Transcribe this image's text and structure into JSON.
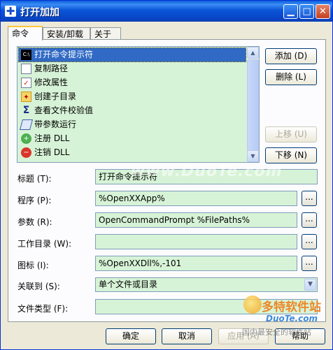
{
  "window": {
    "title": "打开加加",
    "controls": [
      "minimize",
      "maximize",
      "close"
    ]
  },
  "tabs": [
    {
      "label": "命令",
      "active": true
    },
    {
      "label": "安装/卸载",
      "active": false
    },
    {
      "label": "关于",
      "active": false
    }
  ],
  "commands": [
    {
      "label": "打开命令提示符",
      "icon": "console-icon",
      "selected": true
    },
    {
      "label": "复制路径",
      "icon": "document-icon",
      "selected": false
    },
    {
      "label": "修改属性",
      "icon": "checklist-icon",
      "selected": false
    },
    {
      "label": "创建子目录",
      "icon": "new-folder-icon",
      "selected": false
    },
    {
      "label": "查看文件校验值",
      "icon": "sigma-icon",
      "selected": false
    },
    {
      "label": "带参数运行",
      "icon": "run-icon",
      "selected": false
    },
    {
      "label": "注册 DLL",
      "icon": "register-icon",
      "selected": false
    },
    {
      "label": "注销 DLL",
      "icon": "unregister-icon",
      "selected": false
    }
  ],
  "side_buttons": {
    "add": "添加 (D)",
    "delete": "删除 (L)",
    "up": "上移 (U)",
    "down": "下移 (N)"
  },
  "form": {
    "title_label": "标题 (T):",
    "title_value": "打开命令提示符",
    "program_label": "程序 (P):",
    "program_value": "%OpenXXApp%",
    "params_label": "参数 (R):",
    "params_value": "OpenCommandPrompt %FilePaths%",
    "workdir_label": "工作目录 (W):",
    "workdir_value": "",
    "icon_label": "图标 (I):",
    "icon_value": "%OpenXXDll%,-101",
    "assoc_label": "关联到 (S):",
    "assoc_value": "单个文件或目录",
    "filetype_label": "文件类型 (F):",
    "filetype_value": "",
    "browse_label": "..."
  },
  "footer": {
    "ok": "确定",
    "cancel": "取消",
    "apply": "应用 (A)",
    "help": "帮助"
  },
  "watermark": {
    "center": "www.DuoTe.com",
    "logo_cn": "多特软件站",
    "logo_en": "DuoTe.com",
    "logo_sub": "国内最安全的软件站"
  },
  "colors": {
    "field_bg": "#d7f3d7",
    "selection": "#316ac5",
    "title_bar": "#0a5fd8"
  }
}
